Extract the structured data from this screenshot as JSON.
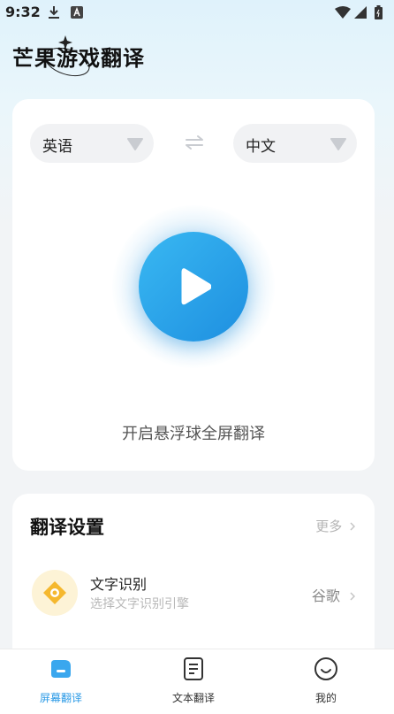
{
  "status_bar": {
    "time": "9:32"
  },
  "header": {
    "app_title": "芒果游戏翻译"
  },
  "language_selector": {
    "source": "英语",
    "target": "中文"
  },
  "floating_translate": {
    "caption": "开启悬浮球全屏翻译"
  },
  "settings": {
    "title": "翻译设置",
    "more": "更多",
    "ocr": {
      "title": "文字识别",
      "subtitle": "选择文字识别引擎",
      "engine": "谷歌"
    }
  },
  "tabs": [
    {
      "label": "屏幕翻译"
    },
    {
      "label": "文本翻译"
    },
    {
      "label": "我的"
    }
  ],
  "colors": {
    "accent": "#2b9ae6",
    "play_gradient_start": "#39b8f2",
    "play_gradient_end": "#1e8fe0"
  }
}
